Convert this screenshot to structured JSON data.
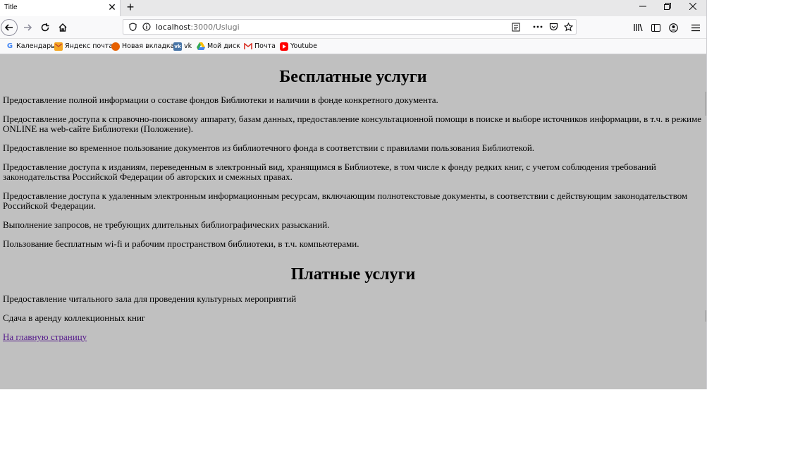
{
  "browser": {
    "tab_title": "Title",
    "tab_close": "✕",
    "new_tab": "+",
    "url_host": "localhost",
    "url_path": ":3000/Uslugi"
  },
  "bookmarks": [
    {
      "label": "Календарь",
      "icon": "google-icon",
      "color": "#4285f4"
    },
    {
      "label": "Яндекс почта",
      "icon": "yandex-mail-icon",
      "color": "#f5a623"
    },
    {
      "label": "Новая вкладка",
      "icon": "firefox-icon",
      "color": "#e66000"
    },
    {
      "label": "vk",
      "icon": "vk-icon",
      "color": "#4a76a8"
    },
    {
      "label": "Мой диск",
      "icon": "google-drive-icon",
      "color": "#34a853"
    },
    {
      "label": "Почта",
      "icon": "gmail-icon",
      "color": "#d93025"
    },
    {
      "label": "Youtube",
      "icon": "youtube-icon",
      "color": "#ff0000"
    }
  ],
  "page": {
    "free_heading": "Бесплатные услуги",
    "free_items": [
      "Предоставление полной информации о составе фондов Библиотеки и наличии в фонде конкретного документа.",
      "Предоставление доступа к справочно-поисковому аппарату, базам данных, предоставление консультационной помощи в поиске и выборе источников информации, в т.ч. в режиме ONLINE на web-сайте Библиотеки (Положение).",
      "Предоставление во временное пользование документов из библиотечного фонда в соответствии с правилами пользования Библиотекой.",
      "Предоставление доступа к изданиям, переведенным в электронный вид, хранящимся в Библиотеке, в том числе к фонду редких книг, с учетом соблюдения требований законодательства Российской Федерации об авторских и смежных правах.",
      "Предоставление доступа к удаленным электронным информационным ресурсам, включающим полнотекстовые документы, в соответствии с действующим законодательством Российской Федерации.",
      "Выполнение запросов, не требующих длительных библиографических разысканий.",
      "Пользование бесплатным wi-fi и рабочим пространством библиотеки, в т.ч. компьютерами."
    ],
    "paid_heading": "Платные услуги",
    "paid_items": [
      "Предоставление читального зала для проведения культурных мероприятий",
      "Сдача в аренду коллекционных книг"
    ],
    "home_link": "На главную страницу"
  }
}
